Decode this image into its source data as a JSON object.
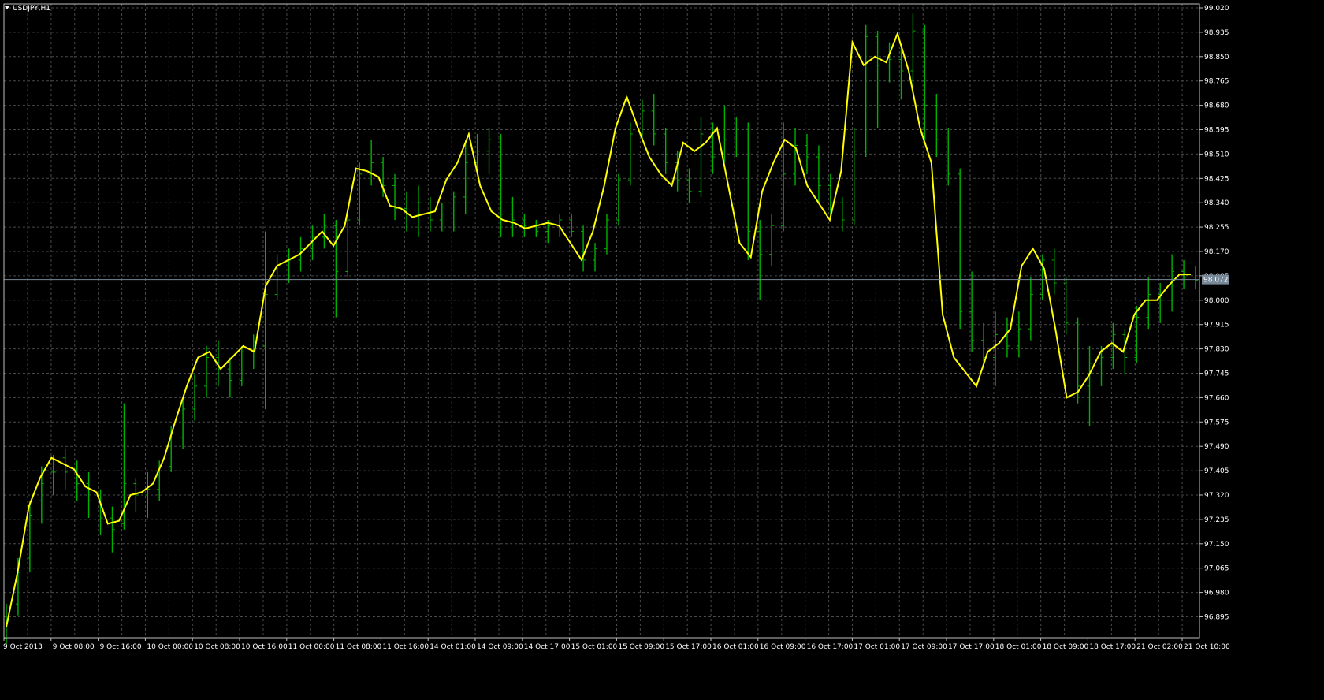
{
  "window": {
    "symbol_title": "USDJPY,H1"
  },
  "colors": {
    "background": "#000000",
    "grid": "#4a4a4a",
    "bars": "#00b200",
    "ma_line": "#ffff00",
    "bid_line": "#778899",
    "axis": "#c0c0c0"
  },
  "chart_data": {
    "type": "line",
    "title": "USDJPY,H1",
    "ylim": [
      96.81,
      99.02
    ],
    "y_ticks": [
      "99.020",
      "98.935",
      "98.850",
      "98.765",
      "98.680",
      "98.595",
      "98.510",
      "98.425",
      "98.340",
      "98.255",
      "98.170",
      "98.085",
      "98.000",
      "97.915",
      "97.830",
      "97.745",
      "97.660",
      "97.575",
      "97.490",
      "97.405",
      "97.320",
      "97.235",
      "97.150",
      "97.065",
      "96.980",
      "96.895"
    ],
    "x_ticks": [
      "9 Oct 2013",
      "9 Oct 08:00",
      "9 Oct 16:00",
      "10 Oct 00:00",
      "10 Oct 08:00",
      "10 Oct 16:00",
      "11 Oct 00:00",
      "11 Oct 08:00",
      "11 Oct 16:00",
      "14 Oct 01:00",
      "14 Oct 09:00",
      "14 Oct 17:00",
      "15 Oct 01:00",
      "15 Oct 09:00",
      "15 Oct 17:00",
      "16 Oct 01:00",
      "16 Oct 09:00",
      "16 Oct 17:00",
      "17 Oct 01:00",
      "17 Oct 09:00",
      "17 Oct 17:00",
      "18 Oct 01:00",
      "18 Oct 09:00",
      "18 Oct 17:00",
      "21 Oct 02:00",
      "21 Oct 10:00"
    ],
    "current_price": "98.072",
    "grid": true,
    "series": [
      {
        "values": [
          96.86,
          97.05,
          97.28,
          97.38,
          97.45,
          97.43,
          97.41,
          97.35,
          97.33,
          97.22,
          97.23,
          97.32,
          97.33,
          97.36,
          97.45,
          97.58,
          97.7,
          97.8,
          97.82,
          97.76,
          97.8,
          97.84,
          97.82,
          98.05,
          98.12,
          98.14,
          98.16,
          98.2,
          98.24,
          98.19,
          98.26,
          98.46,
          98.45,
          98.43,
          98.33,
          98.32,
          98.29,
          98.3,
          98.31,
          98.42,
          98.48,
          98.58,
          98.4,
          98.31,
          98.28,
          98.27,
          98.25,
          98.26,
          98.27,
          98.26,
          98.2,
          98.14,
          98.24,
          98.4,
          98.6,
          98.71,
          98.6,
          98.5,
          98.44,
          98.4,
          98.55,
          98.52,
          98.55,
          98.6,
          98.4,
          98.2,
          98.15,
          98.38,
          98.48,
          98.56,
          98.53,
          98.4,
          98.34,
          98.28,
          98.45,
          98.9,
          98.82,
          98.85,
          98.83,
          98.93,
          98.8,
          98.6,
          98.48,
          97.95,
          97.8,
          97.75,
          97.7,
          97.82,
          97.85,
          97.9,
          98.12,
          98.18,
          98.11,
          97.9,
          97.66,
          97.68,
          97.74,
          97.82,
          97.85,
          97.82,
          97.95,
          98.0,
          98.0,
          98.05,
          98.09,
          98.09
        ]
      },
      {
        "ohlc": [
          [
            96.82,
            96.94,
            96.8,
            96.88
          ],
          [
            96.94,
            97.1,
            96.9,
            97.05
          ],
          [
            97.1,
            97.3,
            97.05,
            97.25
          ],
          [
            97.3,
            97.42,
            97.22,
            97.36
          ],
          [
            97.4,
            97.46,
            97.32,
            97.4
          ],
          [
            97.45,
            97.48,
            97.34,
            97.4
          ],
          [
            97.4,
            97.44,
            97.3,
            97.36
          ],
          [
            97.36,
            97.4,
            97.24,
            97.3
          ],
          [
            97.3,
            97.34,
            97.18,
            97.24
          ],
          [
            97.24,
            97.28,
            97.12,
            97.2
          ],
          [
            97.22,
            97.64,
            97.2,
            97.36
          ],
          [
            97.36,
            97.38,
            97.26,
            97.32
          ],
          [
            97.32,
            97.4,
            97.24,
            97.34
          ],
          [
            97.34,
            97.44,
            97.3,
            97.42
          ],
          [
            97.42,
            97.56,
            97.4,
            97.52
          ],
          [
            97.52,
            97.66,
            97.48,
            97.62
          ],
          [
            97.62,
            97.74,
            97.58,
            97.7
          ],
          [
            97.7,
            97.84,
            97.66,
            97.8
          ],
          [
            97.8,
            97.86,
            97.7,
            97.76
          ],
          [
            97.76,
            97.8,
            97.66,
            97.72
          ],
          [
            97.72,
            97.84,
            97.7,
            97.82
          ],
          [
            97.82,
            97.88,
            97.76,
            97.84
          ],
          [
            97.84,
            98.24,
            97.62,
            98.02
          ],
          [
            98.02,
            98.16,
            98.0,
            98.12
          ],
          [
            98.12,
            98.18,
            98.06,
            98.14
          ],
          [
            98.14,
            98.22,
            98.1,
            98.18
          ],
          [
            98.18,
            98.26,
            98.14,
            98.22
          ],
          [
            98.22,
            98.3,
            98.18,
            98.26
          ],
          [
            98.26,
            98.28,
            97.94,
            98.1
          ],
          [
            98.1,
            98.3,
            98.08,
            98.28
          ],
          [
            98.28,
            98.48,
            98.26,
            98.44
          ],
          [
            98.44,
            98.56,
            98.4,
            98.48
          ],
          [
            98.48,
            98.5,
            98.36,
            98.4
          ],
          [
            98.4,
            98.44,
            98.28,
            98.32
          ],
          [
            98.32,
            98.38,
            98.24,
            98.3
          ],
          [
            98.3,
            98.4,
            98.22,
            98.34
          ],
          [
            98.34,
            98.36,
            98.24,
            98.28
          ],
          [
            98.28,
            98.34,
            98.24,
            98.3
          ],
          [
            98.3,
            98.38,
            98.24,
            98.36
          ],
          [
            98.36,
            98.56,
            98.3,
            98.48
          ],
          [
            98.48,
            98.58,
            98.44,
            98.52
          ],
          [
            98.52,
            98.6,
            98.44,
            98.56
          ],
          [
            98.56,
            98.58,
            98.22,
            98.3
          ],
          [
            98.3,
            98.36,
            98.22,
            98.28
          ],
          [
            98.28,
            98.3,
            98.22,
            98.26
          ],
          [
            98.26,
            98.28,
            98.22,
            98.24
          ],
          [
            98.24,
            98.28,
            98.2,
            98.26
          ],
          [
            98.26,
            98.3,
            98.22,
            98.28
          ],
          [
            98.28,
            98.3,
            98.22,
            98.24
          ],
          [
            98.24,
            98.26,
            98.1,
            98.14
          ],
          [
            98.14,
            98.2,
            98.1,
            98.18
          ],
          [
            98.18,
            98.3,
            98.16,
            98.28
          ],
          [
            98.28,
            98.44,
            98.26,
            98.42
          ],
          [
            98.42,
            98.62,
            98.4,
            98.58
          ],
          [
            98.58,
            98.7,
            98.56,
            98.66
          ],
          [
            98.66,
            98.72,
            98.54,
            98.58
          ],
          [
            98.58,
            98.6,
            98.44,
            98.48
          ],
          [
            98.48,
            98.52,
            98.38,
            98.42
          ],
          [
            98.42,
            98.46,
            98.34,
            98.38
          ],
          [
            98.38,
            98.64,
            98.36,
            98.58
          ],
          [
            98.58,
            98.62,
            98.44,
            98.5
          ],
          [
            98.5,
            98.68,
            98.48,
            98.56
          ],
          [
            98.56,
            98.64,
            98.5,
            98.6
          ],
          [
            98.6,
            98.62,
            98.14,
            98.24
          ],
          [
            98.24,
            98.28,
            98.0,
            98.16
          ],
          [
            98.16,
            98.3,
            98.12,
            98.26
          ],
          [
            98.26,
            98.62,
            98.24,
            98.44
          ],
          [
            98.44,
            98.6,
            98.4,
            98.54
          ],
          [
            98.54,
            98.58,
            98.44,
            98.5
          ],
          [
            98.5,
            98.54,
            98.34,
            98.4
          ],
          [
            98.4,
            98.44,
            98.3,
            98.34
          ],
          [
            98.34,
            98.36,
            98.24,
            98.28
          ],
          [
            98.28,
            98.6,
            98.26,
            98.52
          ],
          [
            98.52,
            98.96,
            98.5,
            98.92
          ],
          [
            98.92,
            98.94,
            98.6,
            98.82
          ],
          [
            98.82,
            98.9,
            98.76,
            98.84
          ],
          [
            98.84,
            98.88,
            98.7,
            98.8
          ],
          [
            98.8,
            99.0,
            98.74,
            98.94
          ],
          [
            98.94,
            98.96,
            98.56,
            98.68
          ],
          [
            98.68,
            98.72,
            98.5,
            98.56
          ],
          [
            98.56,
            98.6,
            98.4,
            98.44
          ],
          [
            98.44,
            98.46,
            97.9,
            97.96
          ],
          [
            97.96,
            98.1,
            97.82,
            97.86
          ],
          [
            97.86,
            97.92,
            97.78,
            97.8
          ],
          [
            97.8,
            97.96,
            97.7,
            97.88
          ],
          [
            97.88,
            97.94,
            97.8,
            97.84
          ],
          [
            97.84,
            97.96,
            97.8,
            97.9
          ],
          [
            97.9,
            98.08,
            97.86,
            98.02
          ],
          [
            98.02,
            98.16,
            98.0,
            98.14
          ],
          [
            98.14,
            98.18,
            98.02,
            98.06
          ],
          [
            98.06,
            98.08,
            97.88,
            97.92
          ],
          [
            97.92,
            97.94,
            97.64,
            97.7
          ],
          [
            97.7,
            97.84,
            97.56,
            97.78
          ],
          [
            97.78,
            97.84,
            97.7,
            97.8
          ],
          [
            97.8,
            97.92,
            97.76,
            97.88
          ],
          [
            97.88,
            97.9,
            97.74,
            97.8
          ],
          [
            97.8,
            97.98,
            97.78,
            97.94
          ],
          [
            97.94,
            98.08,
            97.9,
            98.02
          ],
          [
            98.02,
            98.06,
            97.92,
            98.0
          ],
          [
            98.0,
            98.16,
            97.96,
            98.1
          ],
          [
            98.1,
            98.14,
            98.04,
            98.08
          ],
          [
            98.08,
            98.12,
            98.04,
            98.07
          ]
        ]
      }
    ]
  }
}
